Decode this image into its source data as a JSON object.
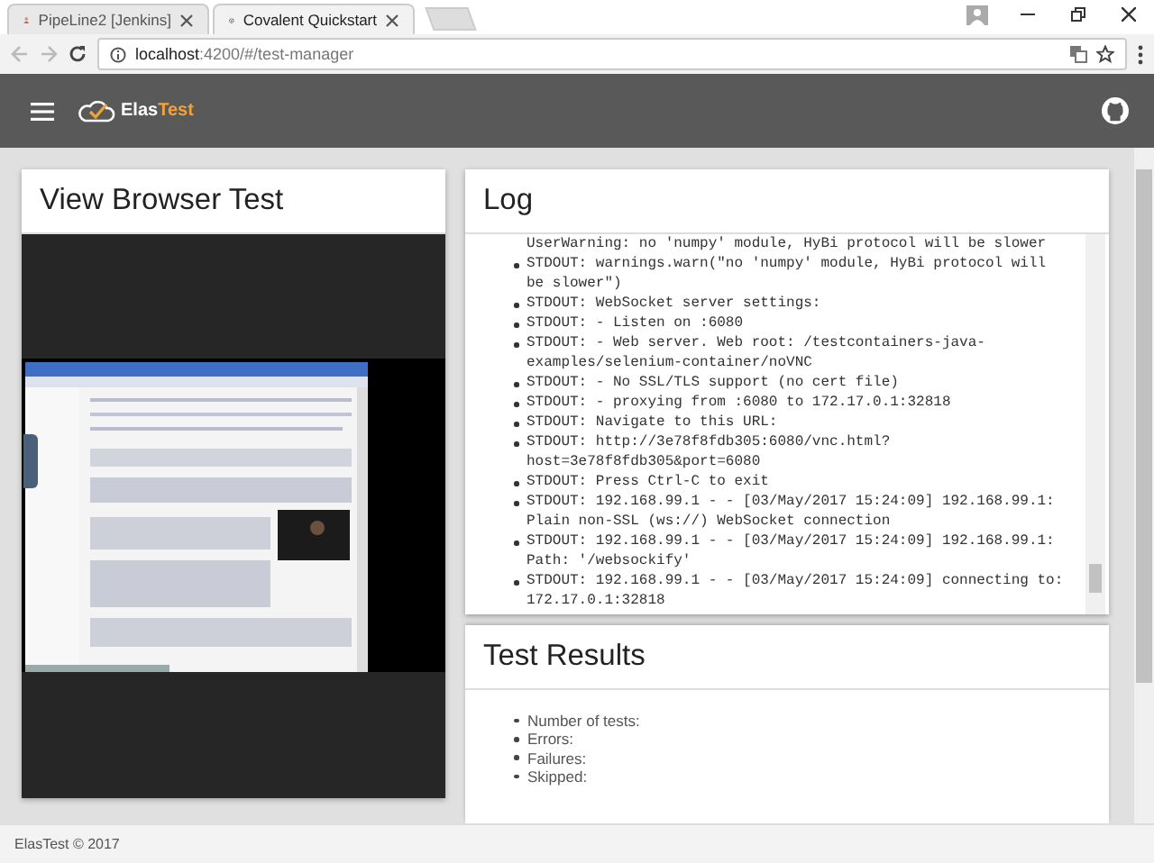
{
  "browser": {
    "tabs": [
      {
        "title": "PipeLine2 [Jenkins]",
        "selected": false
      },
      {
        "title": "Covalent Quickstart",
        "selected": true
      }
    ],
    "url_host": "localhost",
    "url_path": ":4200/#/test-manager"
  },
  "header": {
    "brand": [
      "Elas",
      "Test"
    ]
  },
  "browser_test": {
    "title": "View Browser Test"
  },
  "log": {
    "title": "Log",
    "lines": [
      {
        "kind": "continuation",
        "text": "UserWarning: no 'numpy' module, HyBi protocol will be slower"
      },
      {
        "kind": "entry",
        "text": "STDOUT: warnings.warn(\"no 'numpy' module, HyBi protocol will be slower\")"
      },
      {
        "kind": "entry",
        "text": "STDOUT: WebSocket server settings:"
      },
      {
        "kind": "entry",
        "text": "STDOUT: - Listen on :6080"
      },
      {
        "kind": "entry",
        "text": "STDOUT: - Web server. Web root: /testcontainers-java-examples/selenium-container/noVNC"
      },
      {
        "kind": "entry",
        "text": "STDOUT: - No SSL/TLS support (no cert file)"
      },
      {
        "kind": "entry",
        "text": "STDOUT: - proxying from :6080 to 172.17.0.1:32818"
      },
      {
        "kind": "entry",
        "text": "STDOUT: Navigate to this URL:"
      },
      {
        "kind": "entry",
        "text": "STDOUT: http://3e78f8fdb305:6080/vnc.html? host=3e78f8fdb305&port=6080"
      },
      {
        "kind": "entry",
        "text": "STDOUT: Press Ctrl-C to exit"
      },
      {
        "kind": "entry",
        "text": "STDOUT: 192.168.99.1 - - [03/May/2017 15:24:09] 192.168.99.1: Plain non-SSL (ws://) WebSocket connection"
      },
      {
        "kind": "entry",
        "text": "STDOUT: 192.168.99.1 - - [03/May/2017 15:24:09] 192.168.99.1: Path: '/websockify'"
      },
      {
        "kind": "entry",
        "text": "STDOUT: 192.168.99.1 - - [03/May/2017 15:24:09] connecting to: 172.17.0.1:32818"
      }
    ]
  },
  "test_results": {
    "title": "Test Results",
    "items": [
      "Number of tests:",
      "Errors:",
      "Failures:",
      "Skipped:"
    ]
  },
  "footer": "ElasTest © 2017"
}
